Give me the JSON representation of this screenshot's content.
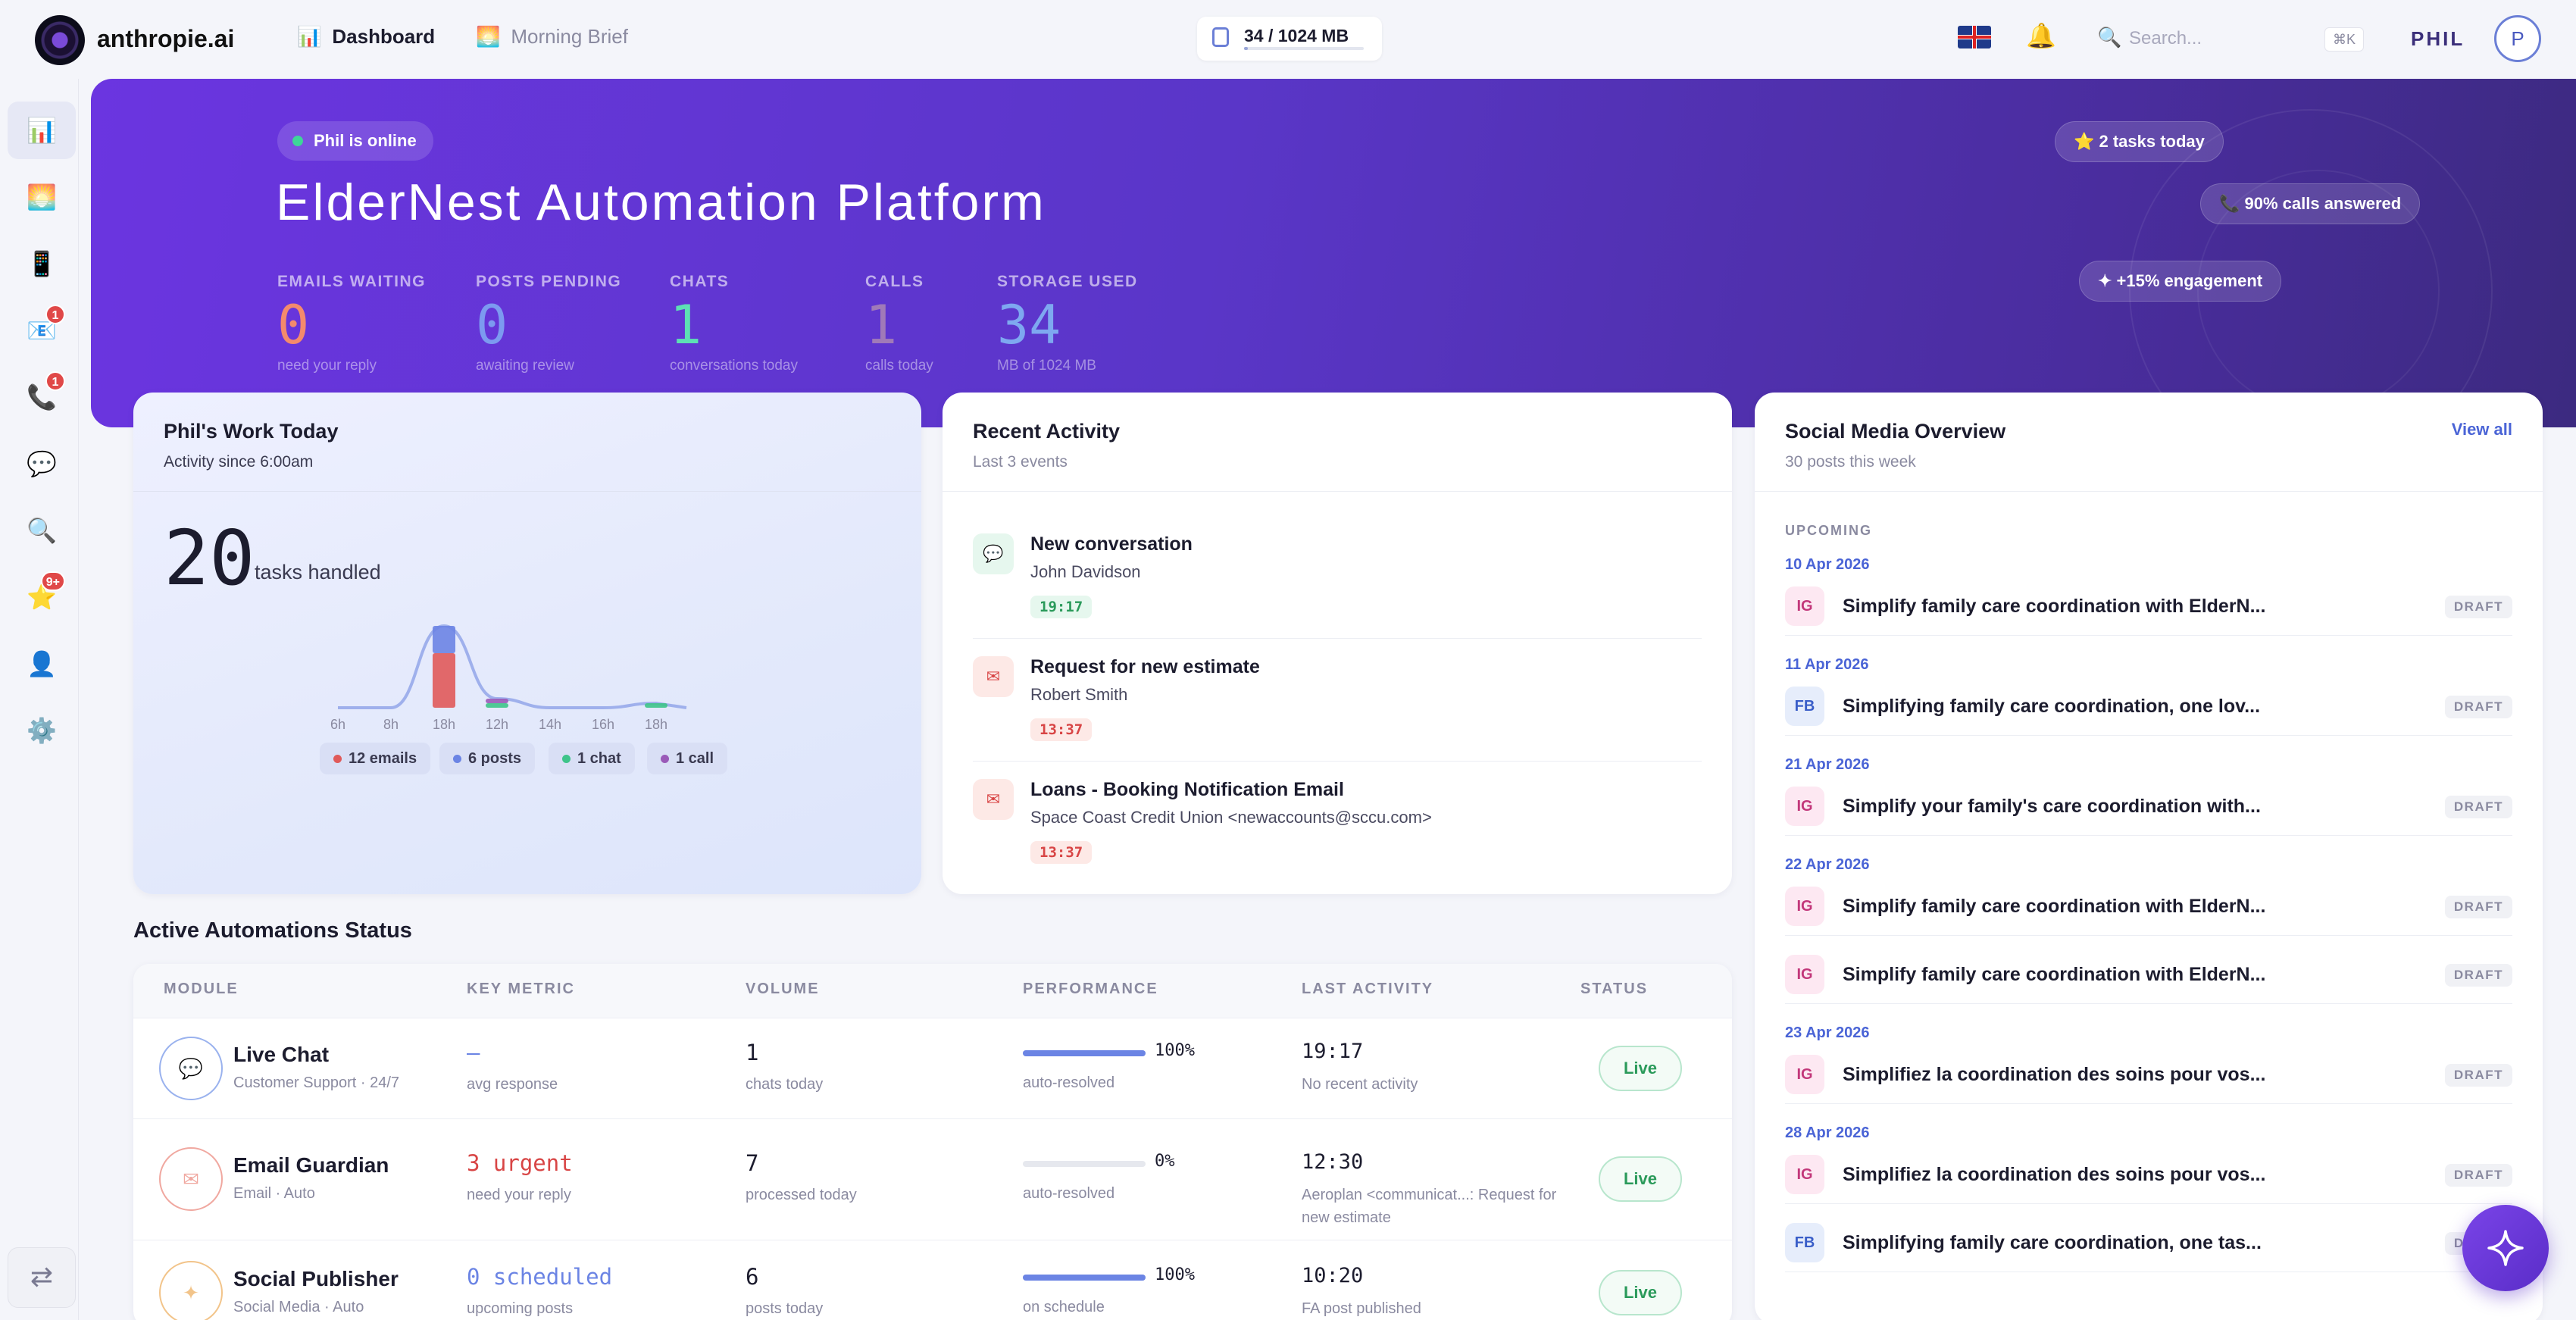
{
  "app": {
    "brand": "anthropie.ai",
    "nav": [
      {
        "label": "Dashboard",
        "icon": "📊"
      },
      {
        "label": "Morning Brief",
        "icon": "🌅"
      }
    ],
    "storage": {
      "label": "34 / 1024 MB",
      "used_fraction": 0.033
    },
    "search": {
      "placeholder": "Search...",
      "shortcut": "⌘K"
    },
    "user": {
      "name": "PHIL",
      "initial": "P"
    }
  },
  "sidebar": {
    "items": [
      {
        "icon": "📊",
        "name": "dashboard",
        "active": true,
        "badge": ""
      },
      {
        "icon": "🌅",
        "name": "morning-brief",
        "badge": ""
      },
      {
        "icon": "📱",
        "name": "social",
        "badge": ""
      },
      {
        "icon": "📧",
        "name": "email",
        "badge": "1"
      },
      {
        "icon": "📞",
        "name": "calls",
        "badge": "1"
      },
      {
        "icon": "💬",
        "name": "chat",
        "badge": ""
      },
      {
        "icon": "🔍",
        "name": "search",
        "badge": ""
      },
      {
        "icon": "⭐",
        "name": "reviews",
        "badge": "9+"
      },
      {
        "icon": "👤",
        "name": "profile",
        "badge": ""
      },
      {
        "icon": "⚙️",
        "name": "settings",
        "badge": ""
      }
    ],
    "toggle": "⇄"
  },
  "hero": {
    "status": "Phil is online",
    "title": "ElderNest Automation Platform",
    "stats": [
      {
        "label": "EMAILS WAITING",
        "value": "0",
        "sub": "need your reply",
        "color": "#f48a6c"
      },
      {
        "label": "POSTS PENDING",
        "value": "0",
        "sub": "awaiting review",
        "color": "#7c9af0"
      },
      {
        "label": "CHATS",
        "value": "1",
        "sub": "conversations today",
        "color": "#5de0b4"
      },
      {
        "label": "CALLS",
        "value": "1",
        "sub": "calls today",
        "color": "#a07ab8"
      },
      {
        "label": "STORAGE USED",
        "value": "34",
        "sub": "MB of 1024 MB",
        "color": "#7ea8f0"
      }
    ],
    "chips": [
      "⭐ 2 tasks today",
      "📞 90% calls answered",
      "✦ +15% engagement"
    ]
  },
  "work": {
    "title": "Phil's Work Today",
    "subtitle": "Activity since 6:00am",
    "count": "20",
    "count_label": "tasks handled",
    "legend": [
      {
        "label": "12 emails",
        "color": "#e05a5a"
      },
      {
        "label": "6 posts",
        "color": "#6b84e4"
      },
      {
        "label": "1 chat",
        "color": "#3ec48a"
      },
      {
        "label": "1 call",
        "color": "#9a5ab8"
      }
    ]
  },
  "chart_data": {
    "type": "bar",
    "categories": [
      "6h",
      "8h",
      "18h",
      "12h",
      "14h",
      "16h",
      "18h"
    ],
    "series": [
      {
        "values": [
          0,
          0,
          12,
          0,
          0,
          0,
          0
        ],
        "color": "#e05a5a"
      },
      {
        "values": [
          0,
          0,
          6,
          0,
          0,
          0,
          0
        ],
        "color": "#6b84e4"
      },
      {
        "values": [
          0,
          0,
          0,
          1,
          0,
          0,
          1
        ],
        "color": "#3ec48a"
      },
      {
        "values": [
          0,
          0,
          0,
          1,
          0,
          0,
          0
        ],
        "color": "#9a5ab8"
      }
    ],
    "title": "",
    "xlabel": "",
    "ylabel": ""
  },
  "recent": {
    "title": "Recent Activity",
    "subtitle": "Last 3 events",
    "items": [
      {
        "icon": "💬",
        "title": "New conversation",
        "person": "John Davidson",
        "time": "19:17",
        "kind": "chat"
      },
      {
        "icon": "✉",
        "title": "Request for new estimate",
        "person": "Robert Smith",
        "time": "13:37",
        "kind": "email"
      },
      {
        "icon": "✉",
        "title": "Loans - Booking Notification Email",
        "person": "Space Coast Credit Union <newaccounts@sccu.com>",
        "time": "13:37",
        "kind": "email"
      }
    ]
  },
  "social": {
    "title": "Social Media Overview",
    "subtitle": "30 posts this week",
    "view_all": "View all",
    "section": "UPCOMING",
    "groups": [
      {
        "date": "10 Apr 2026",
        "posts": [
          {
            "net": "IG",
            "text": "Simplify family care coordination with ElderN...",
            "status": "DRAFT"
          }
        ]
      },
      {
        "date": "11 Apr 2026",
        "posts": [
          {
            "net": "FB",
            "text": "Simplifying family care coordination, one lov...",
            "status": "DRAFT"
          }
        ]
      },
      {
        "date": "21 Apr 2026",
        "posts": [
          {
            "net": "IG",
            "text": "Simplify your family's care coordination with...",
            "status": "DRAFT"
          }
        ]
      },
      {
        "date": "22 Apr 2026",
        "posts": [
          {
            "net": "IG",
            "text": "Simplify family care coordination with ElderN...",
            "status": "DRAFT"
          },
          {
            "net": "IG",
            "text": "Simplify family care coordination with ElderN...",
            "status": "DRAFT"
          }
        ]
      },
      {
        "date": "23 Apr 2026",
        "posts": [
          {
            "net": "IG",
            "text": "Simplifiez la coordination des soins pour vos...",
            "status": "DRAFT"
          }
        ]
      },
      {
        "date": "28 Apr 2026",
        "posts": [
          {
            "net": "IG",
            "text": "Simplifiez la coordination des soins pour vos...",
            "status": "DRAFT"
          },
          {
            "net": "FB",
            "text": "Simplifying family care coordination, one tas...",
            "status": "DRAFT"
          }
        ]
      }
    ]
  },
  "automations": {
    "title": "Active Automations Status",
    "columns": [
      "MODULE",
      "KEY METRIC",
      "VOLUME",
      "PERFORMANCE",
      "LAST ACTIVITY",
      "STATUS"
    ],
    "rows": [
      {
        "icon": "💬",
        "name": "Live Chat",
        "sub": "Customer Support · 24/7",
        "metric": "—",
        "metric_sub": "avg response",
        "metric_color": "#6b84e4",
        "volume": "1",
        "volume_sub": "chats today",
        "perf": 1.0,
        "perf_label": "100%",
        "perf_sub": "auto-resolved",
        "last": "19:17",
        "last_sub": "No recent activity",
        "status": "Live",
        "tone": "#9ab2ee"
      },
      {
        "icon": "✉",
        "name": "Email Guardian",
        "sub": "Email · Auto",
        "metric": "3 urgent",
        "metric_sub": "need your reply",
        "metric_color": "#d84545",
        "volume": "7",
        "volume_sub": "processed today",
        "perf": 0.0,
        "perf_label": "0%",
        "perf_sub": "auto-resolved",
        "last": "12:30",
        "last_sub": "Aeroplan <communicat...: Request for new estimate",
        "status": "Live",
        "tone": "#f0a8a0"
      },
      {
        "icon": "✦",
        "name": "Social Publisher",
        "sub": "Social Media · Auto",
        "metric": "0 scheduled",
        "metric_sub": "upcoming posts",
        "metric_color": "#6b84e4",
        "volume": "6",
        "volume_sub": "posts today",
        "perf": 1.0,
        "perf_label": "100%",
        "perf_sub": "on schedule",
        "last": "10:20",
        "last_sub": "FA post published",
        "status": "Live",
        "tone": "#f2c48a"
      }
    ]
  }
}
